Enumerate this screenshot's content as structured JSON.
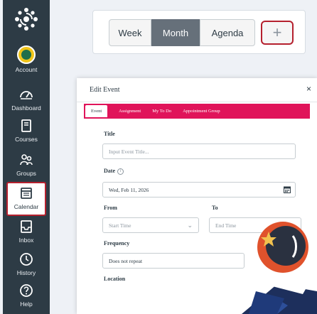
{
  "nav": {
    "items": [
      {
        "key": "account",
        "label": "Account",
        "icon": "account-avatar"
      },
      {
        "key": "dashboard",
        "label": "Dashboard",
        "icon": "dashboard-icon"
      },
      {
        "key": "courses",
        "label": "Courses",
        "icon": "book-icon"
      },
      {
        "key": "groups",
        "label": "Groups",
        "icon": "groups-icon"
      },
      {
        "key": "calendar",
        "label": "Calendar",
        "icon": "calendar-icon",
        "active": true
      },
      {
        "key": "inbox",
        "label": "Inbox",
        "icon": "inbox-icon"
      },
      {
        "key": "history",
        "label": "History",
        "icon": "clock-icon"
      },
      {
        "key": "help",
        "label": "Help",
        "icon": "help-icon"
      }
    ]
  },
  "views": {
    "week": "Week",
    "month": "Month",
    "agenda": "Agenda",
    "selected": "Month",
    "add_symbol": "+"
  },
  "dialog": {
    "title": "Edit Event",
    "close": "×",
    "tabs": [
      "Event",
      "Assignment",
      "My To Do",
      "Appointment Group"
    ],
    "active_tab": "Event",
    "title_label": "Title",
    "title_placeholder": "Input Event Title...",
    "date_label": "Date",
    "date_value": "Wed, Feb 11, 2026",
    "from_label": "From",
    "from_placeholder": "Start Time",
    "to_label": "To",
    "to_placeholder": "End Time",
    "frequency_label": "Frequency",
    "frequency_value": "Does not repeat",
    "location_label": "Location"
  },
  "colors": {
    "nav_bg": "#2d3b45",
    "highlight": "#b5202e",
    "tab_bar": "#e0145a",
    "month_selected": "#66707a"
  }
}
